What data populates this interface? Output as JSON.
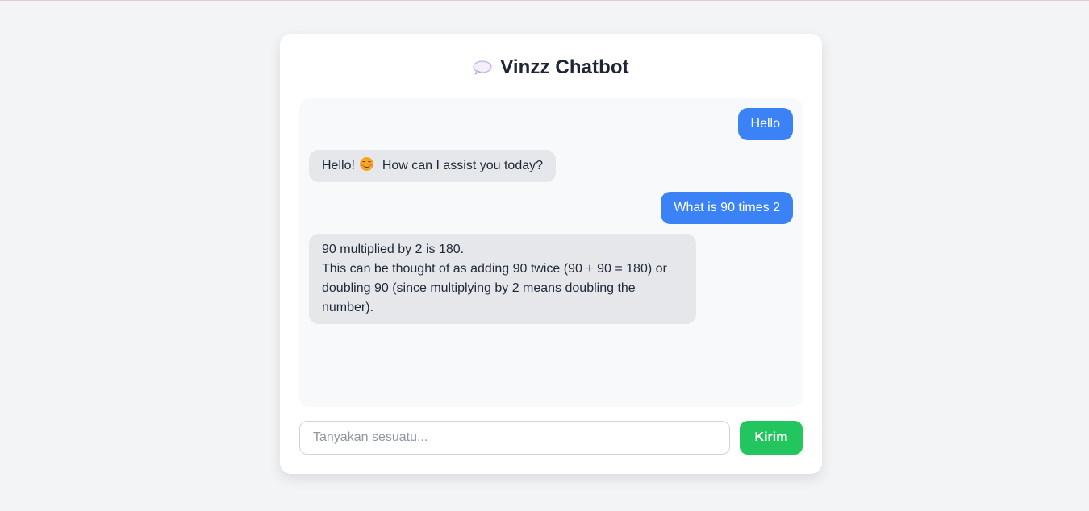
{
  "app": {
    "title": "Vinzz Chatbot",
    "title_icon": "speech-balloon-icon"
  },
  "messages": [
    {
      "role": "user",
      "text": "Hello"
    },
    {
      "role": "bot",
      "text_before_emoji": "Hello!",
      "emoji": "smiling-face-icon",
      "text_after_emoji": "How can I assist you today?"
    },
    {
      "role": "user",
      "text": "What is 90 times 2"
    },
    {
      "role": "bot",
      "lines": [
        "90 multiplied by 2 is 180.",
        "This can be thought of as adding 90 twice (90 + 90 = 180) or doubling 90 (since multiplying by 2 means doubling the number)."
      ]
    }
  ],
  "composer": {
    "placeholder": "Tanyakan sesuatu...",
    "value": "",
    "send_label": "Kirim"
  },
  "colors": {
    "user_bubble": "#3b82f6",
    "bot_bubble": "#e5e7eb",
    "send_button": "#22c55e",
    "page_background": "#f3f4f6"
  }
}
